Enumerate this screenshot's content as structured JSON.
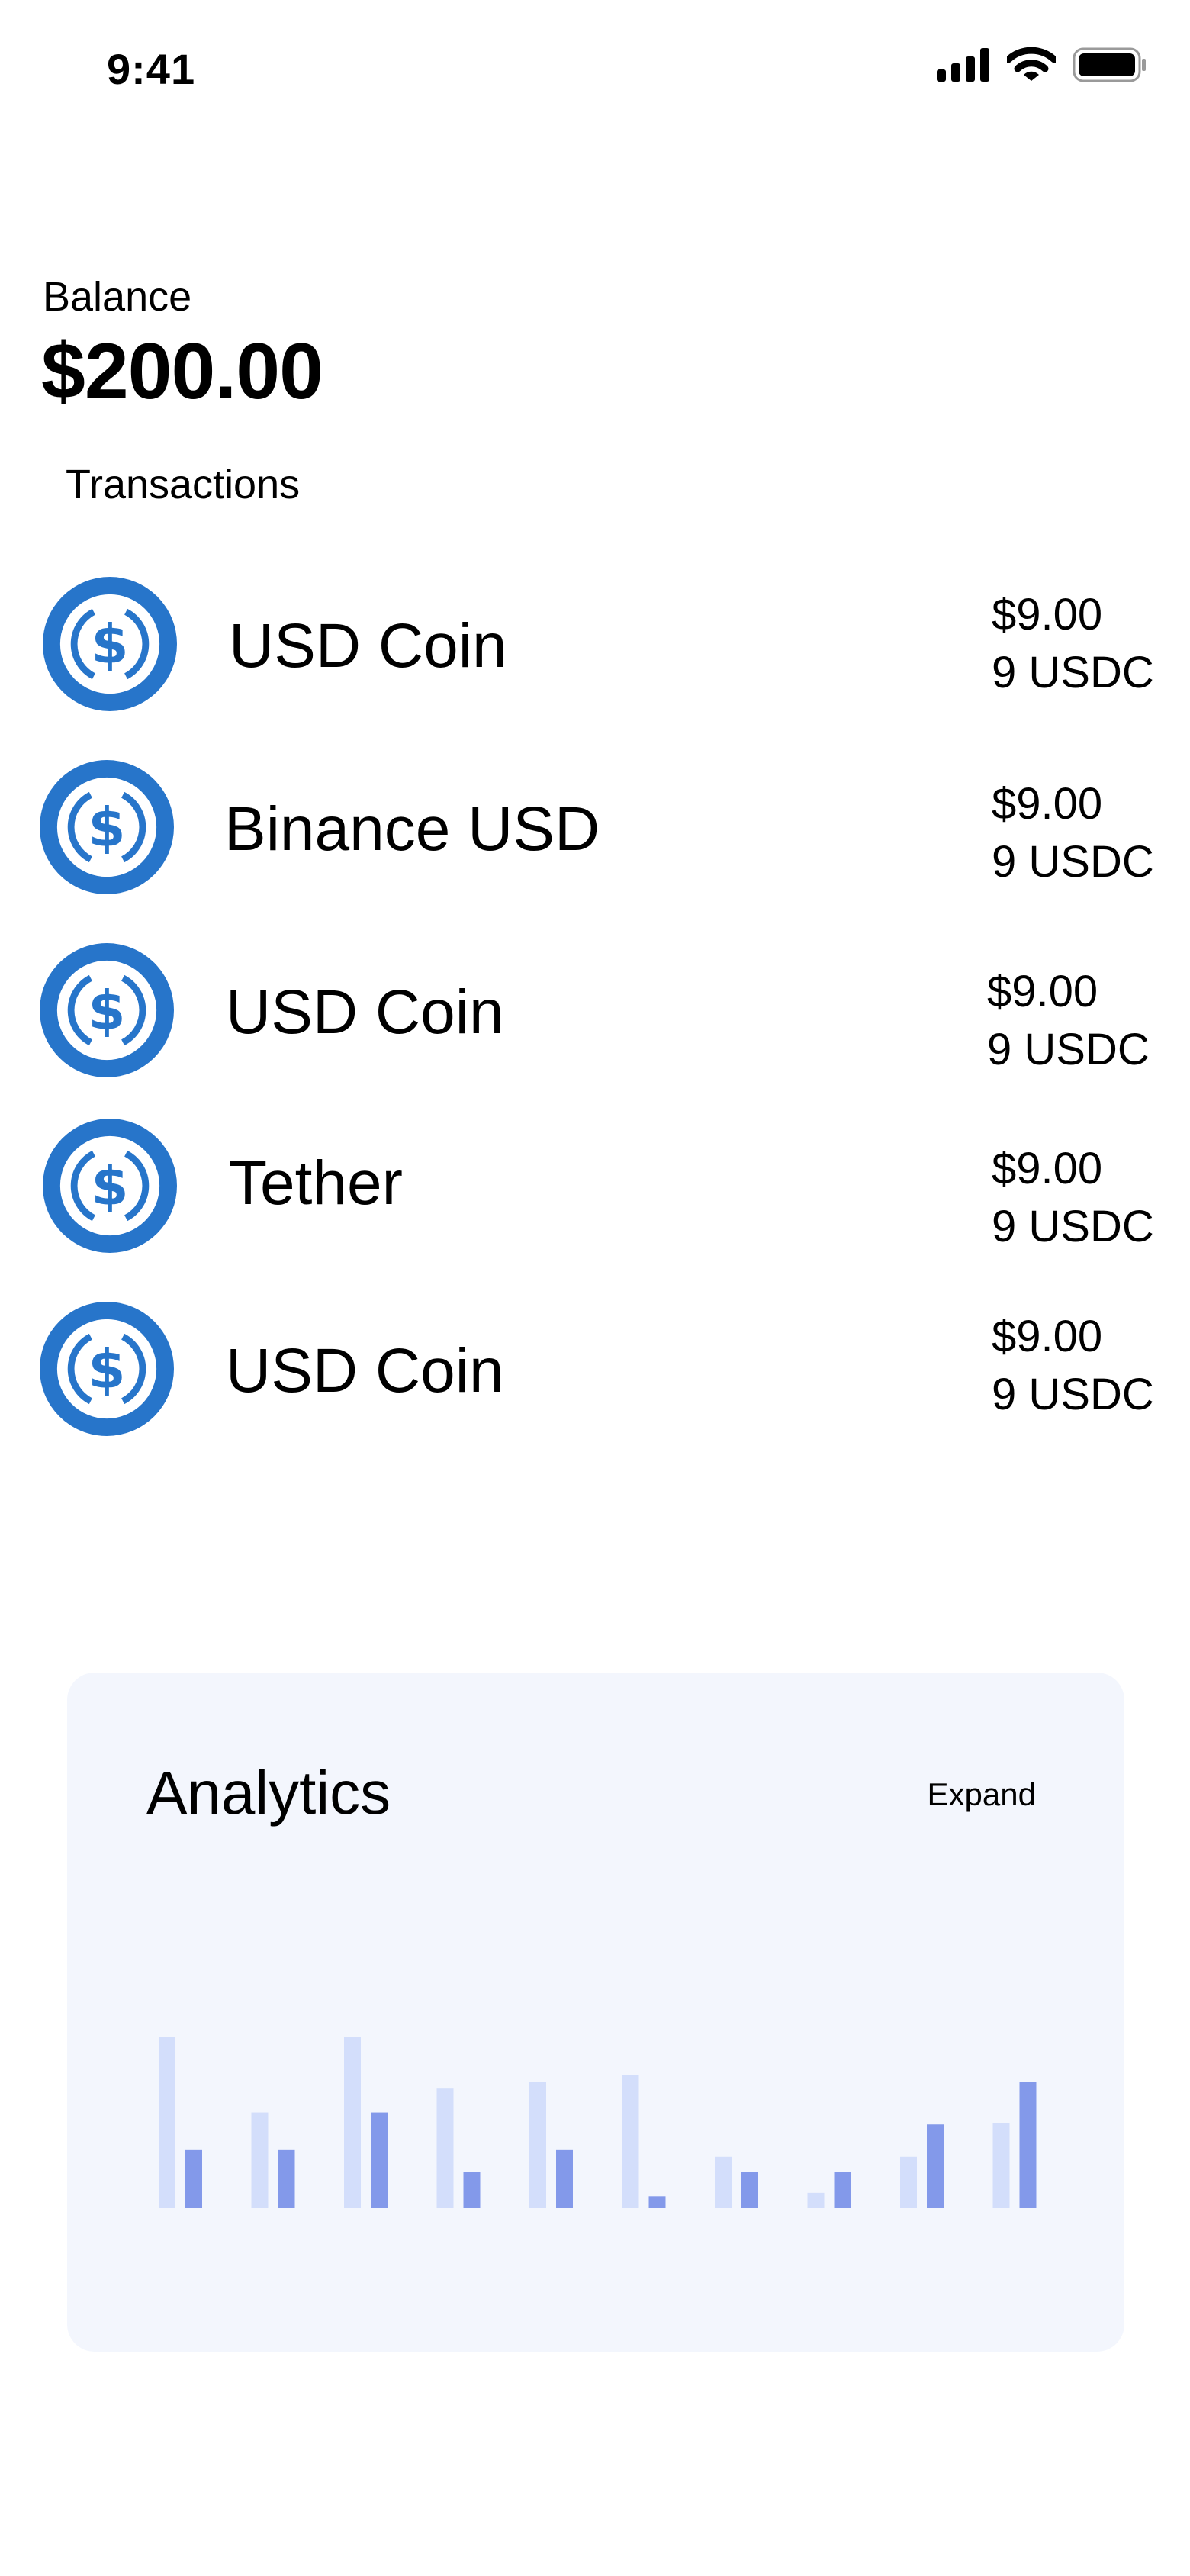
{
  "status_bar": {
    "time": "9:41",
    "icons": [
      "cellular-signal-icon",
      "wifi-icon",
      "battery-icon"
    ]
  },
  "balance": {
    "label": "Balance",
    "value": "$200.00"
  },
  "transactions": {
    "title": "Transactions",
    "items": [
      {
        "name": "USD Coin",
        "amount": "$9.00",
        "token_amount": "9 USDC",
        "icon": "usd-coin-icon"
      },
      {
        "name": "Binance USD",
        "amount": "$9.00",
        "token_amount": "9 USDC",
        "icon": "usd-coin-icon"
      },
      {
        "name": "USD Coin",
        "amount": "$9.00",
        "token_amount": "9 USDC",
        "icon": "usd-coin-icon"
      },
      {
        "name": "Tether",
        "amount": "$9.00",
        "token_amount": "9 USDC",
        "icon": "usd-coin-icon"
      },
      {
        "name": "USD Coin",
        "amount": "$9.00",
        "token_amount": "9 USDC",
        "icon": "usd-coin-icon"
      }
    ]
  },
  "analytics": {
    "title": "Analytics",
    "expand_label": "Expand"
  },
  "colors": {
    "coin_blue": "#2775ca",
    "bar_light": "#d3defb",
    "bar_dark": "#8399ea",
    "card_bg": "#f3f6fd"
  },
  "chart_data": {
    "type": "bar",
    "categories": [
      "",
      "",
      "",
      "",
      "",
      "",
      "",
      "",
      "",
      ""
    ],
    "series": [
      {
        "values": [
          100,
          56,
          100,
          70,
          74,
          78,
          30,
          9,
          30,
          50
        ]
      },
      {
        "values": [
          34,
          34,
          56,
          21,
          34,
          7,
          21,
          21,
          49,
          74
        ]
      }
    ],
    "ylim": [
      0,
      100
    ],
    "grid": false,
    "xlabel": "",
    "ylabel": ""
  }
}
